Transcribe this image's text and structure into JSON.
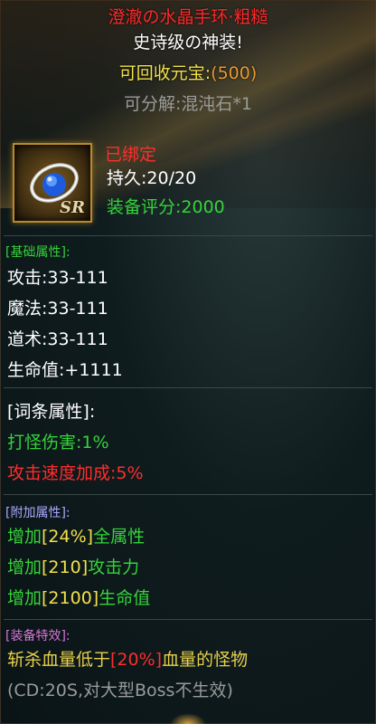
{
  "item": {
    "name": "澄澈の水晶手环·粗糙",
    "grade": "史诗级の神装!",
    "recycle_label": "可回收元宝:",
    "recycle_value": "(500)",
    "decompose": "可分解:混沌石*1",
    "icon_badge": "SR",
    "bound": "已绑定",
    "durability": "持久:20/20",
    "score": "装备评分:2000"
  },
  "base": {
    "header": "[基础属性]:",
    "lines": [
      "攻击:33-111",
      "魔法:33-111",
      "道术:33-111",
      "生命值:+1111"
    ]
  },
  "affix": {
    "header": "[词条属性]:",
    "line1": "打怪伤害:1%",
    "line2": "攻击速度加成:5%"
  },
  "extra": {
    "header": "[附加属性]:",
    "lines": [
      {
        "prefix": "增加",
        "value": "[24%]",
        "suffix": "全属性"
      },
      {
        "prefix": "增加",
        "value": "[210]",
        "suffix": "攻击力"
      },
      {
        "prefix": "增加",
        "value": "[2100]",
        "suffix": "生命值"
      }
    ]
  },
  "effect": {
    "header": "[装备特效]:",
    "line1_prefix": "斩杀血量低于",
    "line1_value": "[20%]",
    "line1_suffix": "血量的怪物",
    "line2": "(CD:20S,对大型Boss不生效)"
  },
  "colors": {
    "name": "#ff2a2a",
    "base_header": "#35d33a",
    "extra_header": "#a9a9ff",
    "effect_header": "#d875d8",
    "value_highlight": "#ff2d2d"
  }
}
